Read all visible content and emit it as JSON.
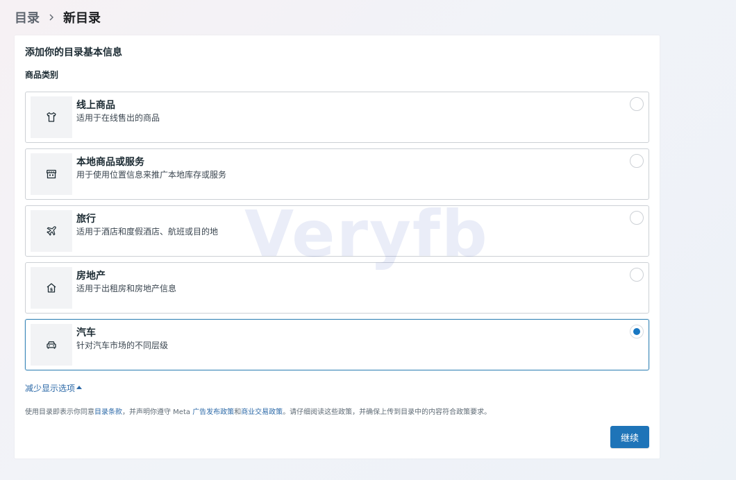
{
  "breadcrumb": {
    "root": "目录",
    "current": "新目录"
  },
  "panel": {
    "title": "添加你的目录基本信息",
    "section_label": "商品类别"
  },
  "options": [
    {
      "title": "线上商品",
      "desc": "适用于在线售出的商品",
      "icon": "shirt-icon",
      "selected": false
    },
    {
      "title": "本地商品或服务",
      "desc": "用于使用位置信息来推广本地库存或服务",
      "icon": "store-icon",
      "selected": false
    },
    {
      "title": "旅行",
      "desc": "适用于酒店和度假酒店、航班或目的地",
      "icon": "airplane-icon",
      "selected": false
    },
    {
      "title": "房地产",
      "desc": "适用于出租房和房地产信息",
      "icon": "house-icon",
      "selected": false
    },
    {
      "title": "汽车",
      "desc": "针对汽车市场的不同层级",
      "icon": "car-icon",
      "selected": true
    }
  ],
  "toggle_label": "减少显示选项",
  "terms": {
    "part1": "使用目录即表示你同意",
    "link1": "目录条款",
    "part2": "，并声明你遵守 Meta ",
    "link2": "广告发布政策",
    "part3": "和",
    "link3": "商业交易政策",
    "part4": "。请仔细阅读这些政策，并确保上传到目录中的内容符合政策要求。"
  },
  "continue_label": "继续",
  "watermark": "Veryfb",
  "colors": {
    "accent": "#1e74b8",
    "link": "#2d6aa8",
    "selected_border": "#3a87b8"
  }
}
